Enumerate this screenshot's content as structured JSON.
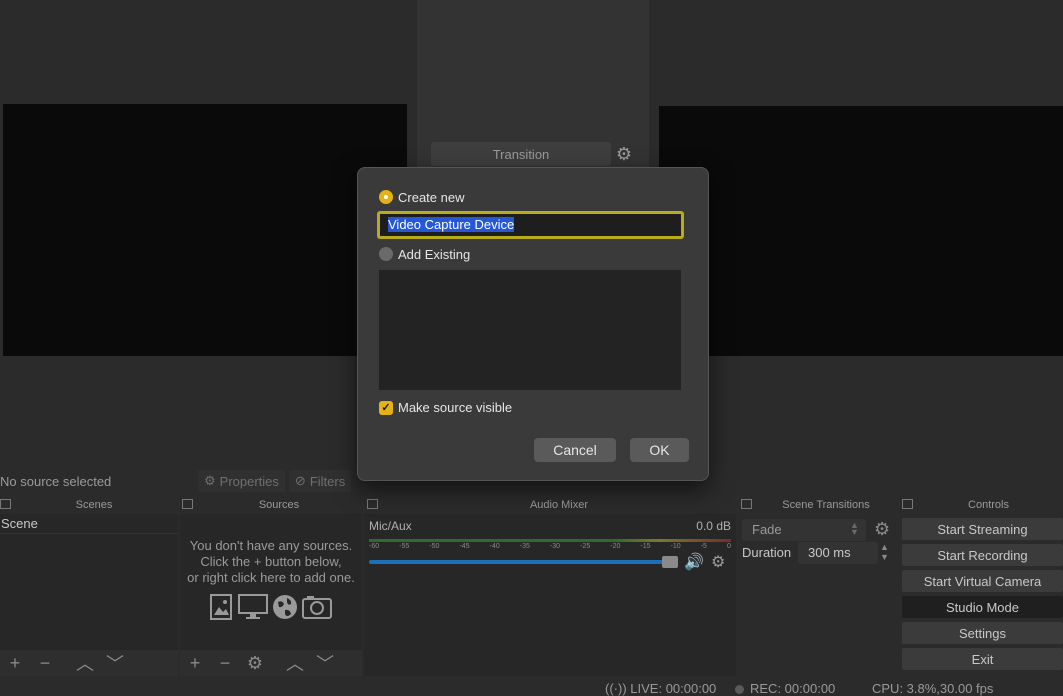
{
  "preview": {
    "transition_label": "Transition"
  },
  "source_bar": {
    "no_source": "No source selected",
    "properties": "Properties",
    "filters": "Filters"
  },
  "docks": {
    "scenes_title": "Scenes",
    "sources_title": "Sources",
    "mixer_title": "Audio Mixer",
    "transitions_title": "Scene Transitions",
    "controls_title": "Controls"
  },
  "scenes": {
    "items": [
      "Scene"
    ]
  },
  "sources": {
    "empty_line1": "You don't have any sources.",
    "empty_line2": "Click the + button below,",
    "empty_line3": "or right click here to add one."
  },
  "mixer": {
    "channel_name": "Mic/Aux",
    "level": "0.0 dB",
    "scale": [
      "-60",
      "-55",
      "-50",
      "-45",
      "-40",
      "-35",
      "-30",
      "-25",
      "-20",
      "-15",
      "-10",
      "-5",
      "0"
    ]
  },
  "transitions": {
    "selected": "Fade",
    "duration_label": "Duration",
    "duration_value": "300 ms"
  },
  "controls": {
    "start_streaming": "Start Streaming",
    "start_recording": "Start Recording",
    "start_virtual_camera": "Start Virtual Camera",
    "studio_mode": "Studio Mode",
    "settings": "Settings",
    "exit": "Exit"
  },
  "status": {
    "live": "LIVE: 00:00:00",
    "rec": "REC: 00:00:00",
    "cpu": "CPU: 3.8%,30.00 fps"
  },
  "dialog": {
    "create_new": "Create new",
    "name_value": "Video Capture Device",
    "add_existing": "Add Existing",
    "make_visible": "Make source visible",
    "cancel": "Cancel",
    "ok": "OK"
  },
  "colors": {
    "accent": "#e4b116",
    "selection": "#2458d6",
    "slider": "#1c6fb8"
  }
}
